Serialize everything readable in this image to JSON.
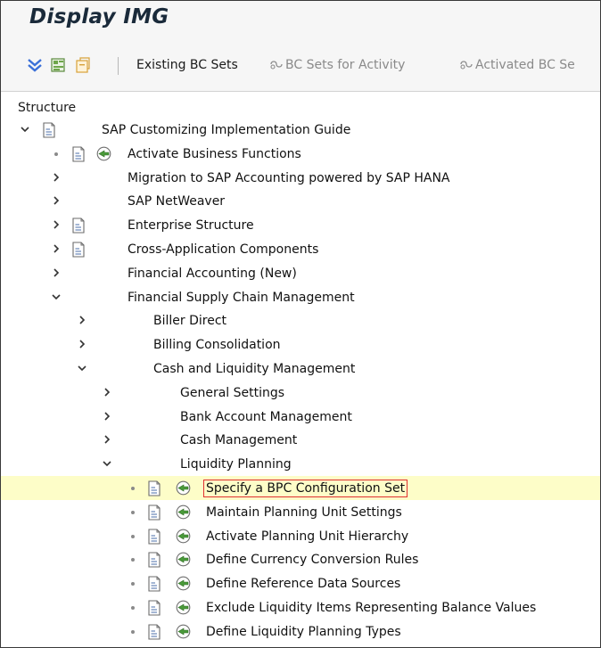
{
  "window": {
    "title": "Display IMG"
  },
  "toolbar": {
    "existing_bc_sets": "Existing BC Sets",
    "bc_sets_for_activity": "BC Sets for Activity",
    "activated_bc_sets": "Activated BC Se"
  },
  "structure": {
    "header": "Structure"
  },
  "tree": [
    {
      "label": "SAP Customizing Implementation Guide",
      "level": 0,
      "expander": "expanded",
      "doc": true,
      "exec": false
    },
    {
      "label": "Activate Business Functions",
      "level": 1,
      "expander": "leaf",
      "doc": true,
      "exec": true
    },
    {
      "label": "Migration to SAP Accounting powered by SAP HANA",
      "level": 1,
      "expander": "collapsed",
      "doc": false,
      "exec": false
    },
    {
      "label": "SAP NetWeaver",
      "level": 1,
      "expander": "collapsed",
      "doc": false,
      "exec": false
    },
    {
      "label": "Enterprise Structure",
      "level": 1,
      "expander": "collapsed",
      "doc": true,
      "exec": false
    },
    {
      "label": "Cross-Application Components",
      "level": 1,
      "expander": "collapsed",
      "doc": true,
      "exec": false
    },
    {
      "label": "Financial Accounting (New)",
      "level": 1,
      "expander": "collapsed",
      "doc": false,
      "exec": false
    },
    {
      "label": "Financial Supply Chain Management",
      "level": 1,
      "expander": "expanded",
      "doc": false,
      "exec": false
    },
    {
      "label": "Biller Direct",
      "level": 2,
      "expander": "collapsed",
      "doc": false,
      "exec": false
    },
    {
      "label": "Billing Consolidation",
      "level": 2,
      "expander": "collapsed",
      "doc": false,
      "exec": false
    },
    {
      "label": "Cash and Liquidity Management",
      "level": 2,
      "expander": "expanded",
      "doc": false,
      "exec": false
    },
    {
      "label": "General Settings",
      "level": 3,
      "expander": "collapsed",
      "doc": false,
      "exec": false
    },
    {
      "label": "Bank Account Management",
      "level": 3,
      "expander": "collapsed",
      "doc": false,
      "exec": false
    },
    {
      "label": "Cash Management",
      "level": 3,
      "expander": "collapsed",
      "doc": false,
      "exec": false
    },
    {
      "label": "Liquidity Planning",
      "level": 3,
      "expander": "expanded",
      "doc": false,
      "exec": false
    },
    {
      "label": "Specify a BPC Configuration Set",
      "level": 4,
      "expander": "leaf",
      "doc": true,
      "exec": true,
      "selected": true
    },
    {
      "label": "Maintain Planning Unit Settings",
      "level": 4,
      "expander": "leaf",
      "doc": true,
      "exec": true
    },
    {
      "label": "Activate Planning Unit Hierarchy",
      "level": 4,
      "expander": "leaf",
      "doc": true,
      "exec": true
    },
    {
      "label": "Define Currency Conversion Rules",
      "level": 4,
      "expander": "leaf",
      "doc": true,
      "exec": true
    },
    {
      "label": "Define Reference Data Sources",
      "level": 4,
      "expander": "leaf",
      "doc": true,
      "exec": true
    },
    {
      "label": "Exclude Liquidity Items Representing Balance Values",
      "level": 4,
      "expander": "leaf",
      "doc": true,
      "exec": true
    },
    {
      "label": "Define Liquidity Planning Types",
      "level": 4,
      "expander": "leaf",
      "doc": true,
      "exec": true
    }
  ],
  "colors": {
    "selection_bg": "#fdfdc8",
    "focus_border": "#e03030",
    "expand_blue": "#3a6fd8",
    "exec_green": "#4a9a3a"
  }
}
